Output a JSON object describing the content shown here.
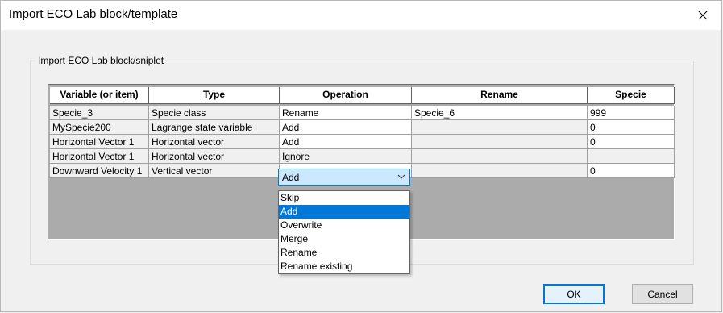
{
  "window": {
    "title": "Import ECO Lab block/template"
  },
  "group": {
    "label": "Import ECO Lab block/sniplet"
  },
  "grid": {
    "columns": [
      "Variable (or item)",
      "Type",
      "Operation",
      "Rename",
      "Specie"
    ],
    "rows": [
      {
        "variable": "Specie_3",
        "type": "Specie class",
        "operation": "Rename",
        "rename": "Specie_6",
        "specie": "999"
      },
      {
        "variable": "MySpecie200",
        "type": "Lagrange state variable",
        "operation": "Add",
        "rename": "",
        "specie": "0"
      },
      {
        "variable": "Horizontal Vector 1",
        "type": "Horizontal vector",
        "operation": "Add",
        "rename": "",
        "specie": "0"
      },
      {
        "variable": "Horizontal Vector 1",
        "type": "Horizontal vector",
        "operation": "Ignore",
        "rename": "",
        "specie": ""
      },
      {
        "variable": "Downward Velocity 1",
        "type": "Vertical vector",
        "operation": "Add",
        "rename": "",
        "specie": "0"
      }
    ]
  },
  "operation_dropdown": {
    "selected": "Add",
    "options": [
      "Skip",
      "Add",
      "Overwrite",
      "Merge",
      "Rename",
      "Rename existing"
    ],
    "highlighted": "Add"
  },
  "buttons": {
    "ok": "OK",
    "cancel": "Cancel"
  },
  "colors": {
    "accent": "#0078d7",
    "selection": "#cce8ff",
    "grid_bg": "#ababab"
  }
}
